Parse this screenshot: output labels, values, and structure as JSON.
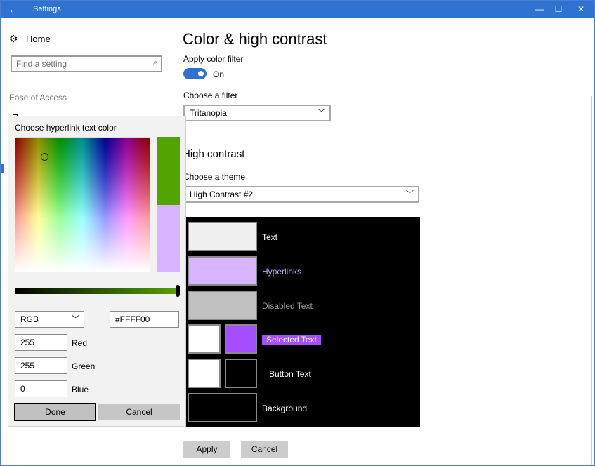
{
  "titlebar": {
    "title": "Settings",
    "back": "←",
    "minimize": "—",
    "maximize": "☐",
    "close": "✕"
  },
  "sidebar": {
    "home_label": "Home",
    "search_placeholder": "Find a setting",
    "section_label": "Ease of Access"
  },
  "main": {
    "title": "Color & high contrast",
    "color_filter": {
      "label": "Apply color filter",
      "toggle_state": "On"
    },
    "filter": {
      "label": "Choose a filter",
      "value": "Tritanopia"
    },
    "high_contrast": {
      "heading": "High contrast",
      "theme_label": "Choose a theme",
      "theme_value": "High Contrast #2"
    },
    "preview": {
      "text": "Text",
      "hyperlinks": "Hyperlinks",
      "disabled_text": "Disabled Text",
      "selected_text": "Selected Text",
      "button_text": "Button Text",
      "background": "Background"
    },
    "apply_label": "Apply",
    "cancel_label": "Cancel"
  },
  "picker": {
    "title": "Choose hyperlink text color",
    "mode": "RGB",
    "hex": "#FFFF00",
    "red": {
      "value": "255",
      "label": "Red"
    },
    "green": {
      "value": "255",
      "label": "Green"
    },
    "blue": {
      "value": "0",
      "label": "Blue"
    },
    "done_label": "Done",
    "cancel_label": "Cancel"
  },
  "colors": {
    "accent": "#2e73d0",
    "text_swatch": "#f0f0f0",
    "hyperlink_swatch": "#d8b4fe",
    "hyperlink_text": "#c8a2ff",
    "disabled_swatch": "#c0c0c0",
    "disabled_text": "#a0a0a0",
    "selected_bg": "#a64dff",
    "new_color": "#54a400"
  }
}
